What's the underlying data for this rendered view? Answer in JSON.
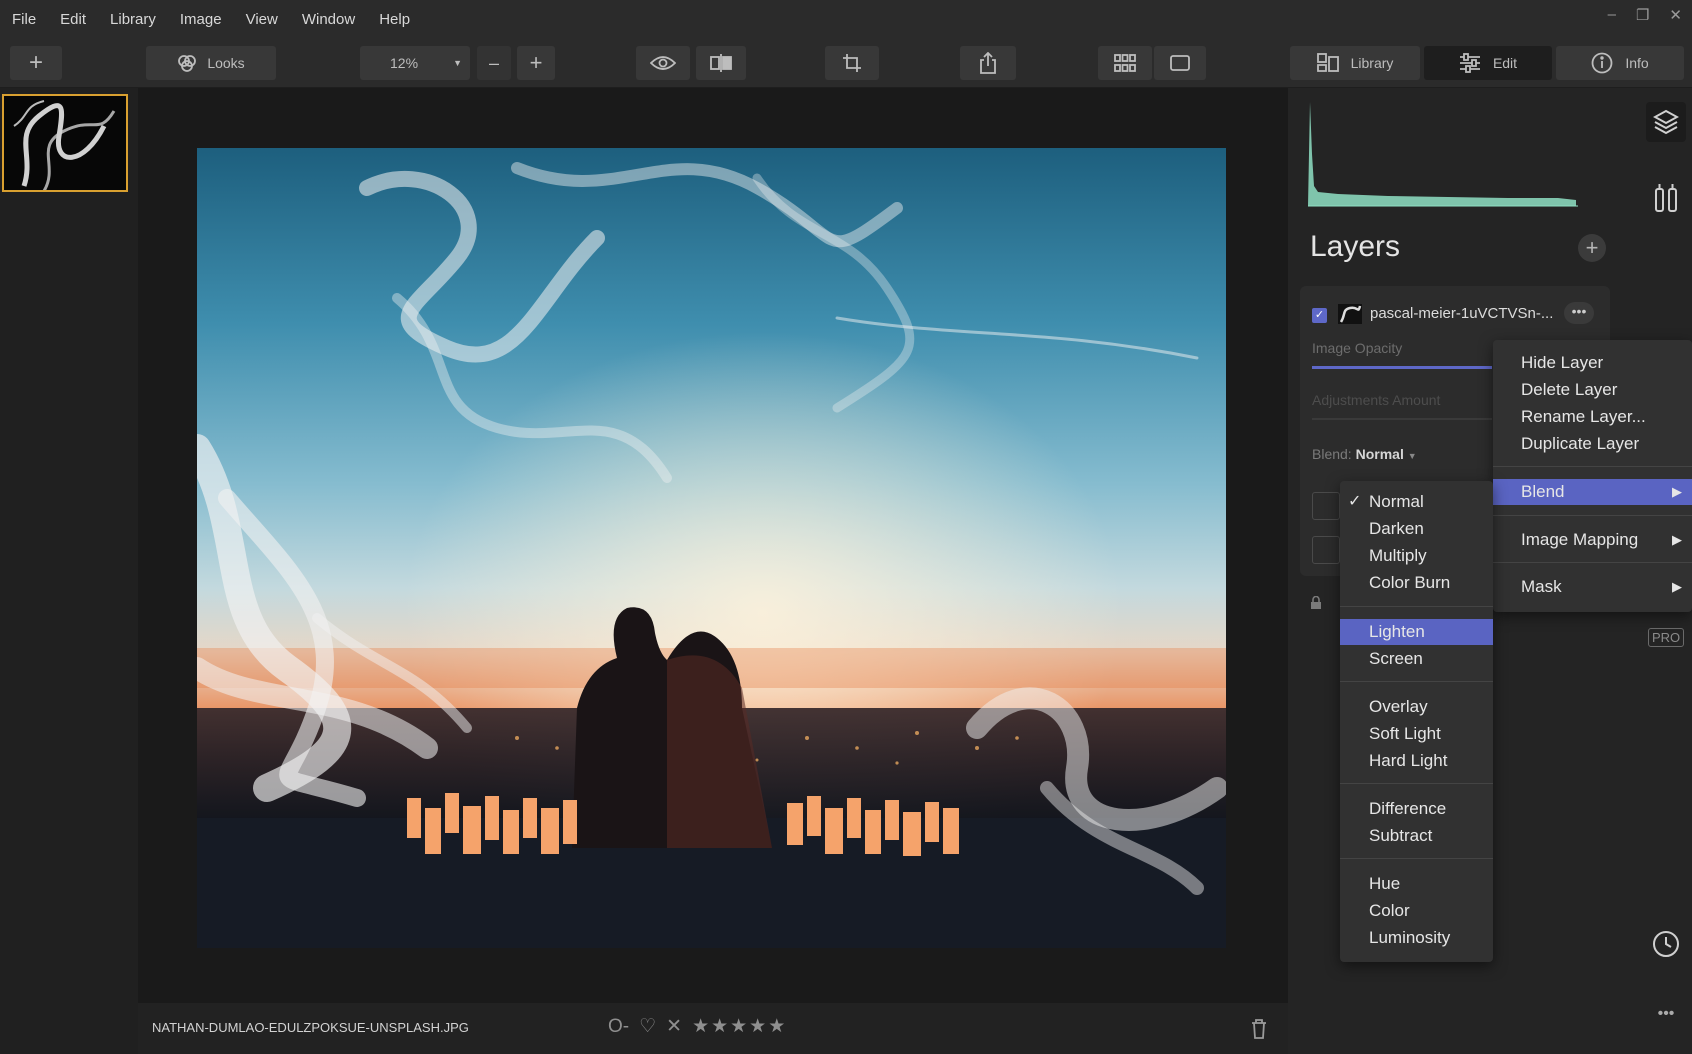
{
  "menubar": {
    "items": [
      "File",
      "Edit",
      "Library",
      "Image",
      "View",
      "Window",
      "Help"
    ],
    "window_controls": [
      "–",
      "❐",
      "✕"
    ]
  },
  "toolbar": {
    "add_glyph": "+",
    "looks_label": "Looks",
    "zoom_value": "12%",
    "zoom_out_glyph": "–",
    "zoom_in_glyph": "+",
    "library_tab": "Library",
    "edit_tab": "Edit",
    "info_tab": "Info",
    "active_tab": "Edit"
  },
  "status": {
    "filename": "NATHAN-DUMLAO-EDULZPOKSUE-UNSPLASH.JPG",
    "flag_glyph": "O-",
    "heart_glyph": "♡",
    "reject_glyph": "✕",
    "stars": "★★★★★"
  },
  "layers_panel": {
    "title": "Layers",
    "add_glyph": "+",
    "layer": {
      "name": "pascal-meier-1uVCTVSn-...",
      "checked": true,
      "more_glyph": "•••"
    },
    "image_opacity_label": "Image Opacity",
    "adjustments_label": "Adjustments Amount",
    "blend_label": "Blend:",
    "blend_value": "Normal",
    "pro_badge": "PRO"
  },
  "context_menu": {
    "items": [
      "Hide Layer",
      "Delete Layer",
      "Rename Layer...",
      "Duplicate Layer"
    ],
    "blend": "Blend",
    "image_mapping": "Image Mapping",
    "mask": "Mask",
    "arrow_glyph": "▶"
  },
  "blend_menu": {
    "checkmark": "✓",
    "selected": "Normal",
    "highlighted": "Lighten",
    "groups": [
      [
        "Normal",
        "Darken",
        "Multiply",
        "Color Burn"
      ],
      [
        "Lighten",
        "Screen"
      ],
      [
        "Overlay",
        "Soft Light",
        "Hard Light"
      ],
      [
        "Difference",
        "Subtract"
      ],
      [
        "Hue",
        "Color",
        "Luminosity"
      ]
    ]
  },
  "colors": {
    "accent": "#5a64c2",
    "selection_border": "#d9a030",
    "histogram": "#8fe0c4"
  }
}
